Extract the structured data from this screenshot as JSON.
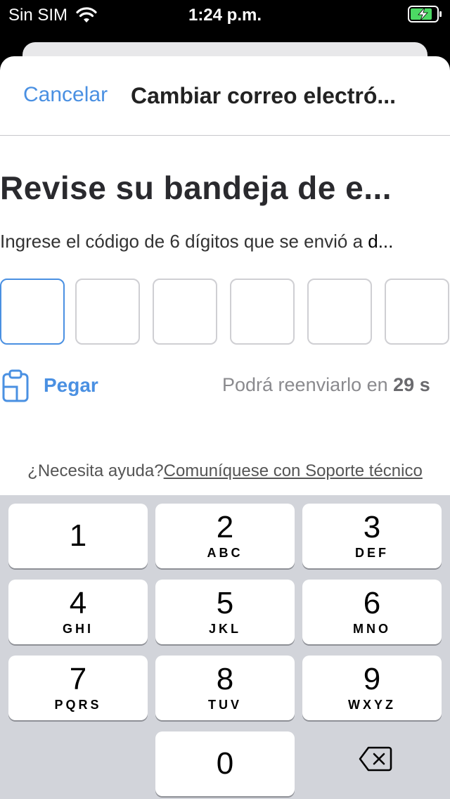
{
  "status": {
    "carrier": "Sin SIM",
    "time": "1:24 p.m."
  },
  "nav": {
    "cancel_label": "Cancelar",
    "title": "Cambiar correo electró..."
  },
  "main": {
    "heading": "Revise su bandeja de e...",
    "subtitle_prefix": "Ingrese el código de 6 dígitos que se envió a ",
    "subtitle_email": "d...",
    "paste_label": "Pegar",
    "resend_prefix": "Podrá reenviarlo en ",
    "resend_seconds": "29 s",
    "help_prefix": "¿Necesita ayuda?",
    "help_link": "Comuníquese con Soporte técnico"
  },
  "keypad": {
    "keys": [
      {
        "num": "1",
        "letters": ""
      },
      {
        "num": "2",
        "letters": "ABC"
      },
      {
        "num": "3",
        "letters": "DEF"
      },
      {
        "num": "4",
        "letters": "GHI"
      },
      {
        "num": "5",
        "letters": "JKL"
      },
      {
        "num": "6",
        "letters": "MNO"
      },
      {
        "num": "7",
        "letters": "PQRS"
      },
      {
        "num": "8",
        "letters": "TUV"
      },
      {
        "num": "9",
        "letters": "WXYZ"
      }
    ],
    "zero": "0"
  },
  "colors": {
    "accent": "#4a90e2",
    "keypad_bg": "#d2d4da"
  },
  "icons": {
    "wifi": "wifi-icon",
    "battery": "battery-charging-icon",
    "paste": "clipboard-icon",
    "backspace": "backspace-icon"
  }
}
